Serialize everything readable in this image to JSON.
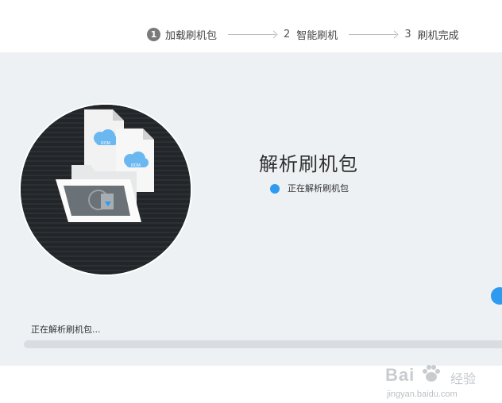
{
  "steps": [
    {
      "num": "1",
      "label": "加载刷机包",
      "active": true
    },
    {
      "num": "2",
      "label": "智能刷机",
      "active": false
    },
    {
      "num": "3",
      "label": "刷机完成",
      "active": false
    }
  ],
  "panel": {
    "title": "解析刷机包",
    "status": "正在解析刷机包"
  },
  "illustration": {
    "badge_text": "ROM",
    "icons": [
      "folder-icon",
      "rom-file-icon",
      "cloud-icon"
    ]
  },
  "footer": {
    "status": "正在解析刷机包...",
    "progress": 0.0
  },
  "watermark": {
    "brand": "Bai  ",
    "cn": "经验",
    "url": "jingyan.baidu.com"
  },
  "colors": {
    "accent": "#2e9af0",
    "panel_bg": "#eef1f4",
    "illustration_bg": "#232629"
  }
}
